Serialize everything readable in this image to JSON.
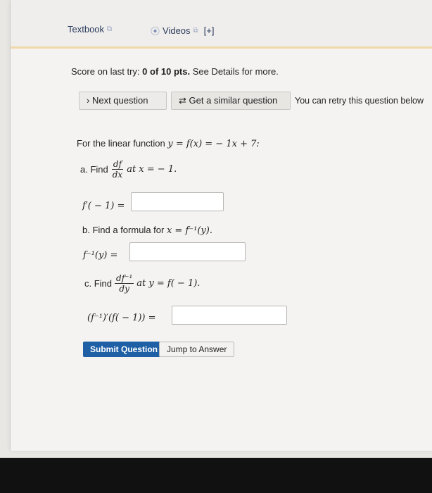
{
  "links": {
    "textbook": "Textbook",
    "videos": "Videos",
    "plus": "[+]"
  },
  "score": {
    "prefix": "Score on last try: ",
    "value": "0 of 10 pts.",
    "suffix": " See Details for more."
  },
  "buttons": {
    "next": "Next question",
    "similar": "Get a similar question",
    "retry_note": "You can retry this question below"
  },
  "problem": {
    "intro": "For the linear function",
    "equation": "y = f(x) = − 1x + 7:",
    "a_label": "a. Find",
    "a_frac_num": "df",
    "a_frac_den": "dx",
    "a_at": "at x = − 1.",
    "a_lhs": "f′( − 1) =",
    "b_text": "b. Find a formula for",
    "b_math": "x = f⁻¹(y).",
    "b_lhs": "f⁻¹(y) =",
    "c_label": "c. Find",
    "c_frac_num": "df⁻¹",
    "c_frac_den": "dy",
    "c_at": "at y = f( − 1).",
    "c_lhs": "(f⁻¹)′(f( − 1)) ="
  },
  "actions": {
    "submit": "Submit Question",
    "jump": "Jump to Answer"
  }
}
